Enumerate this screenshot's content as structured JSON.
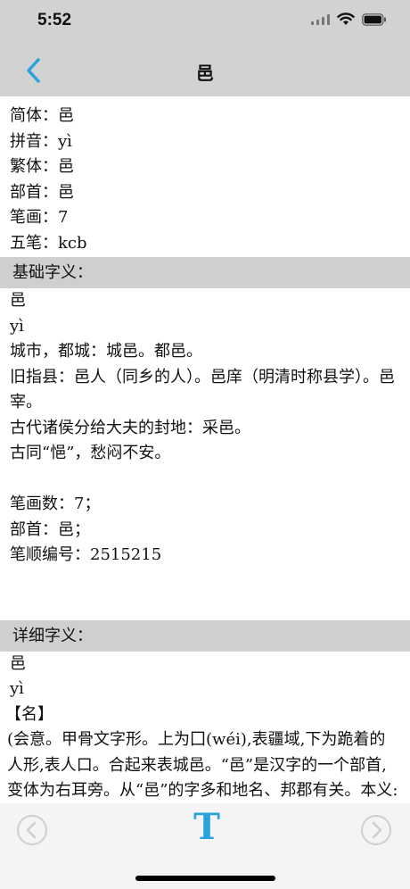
{
  "status": {
    "time": "5:52"
  },
  "nav": {
    "title": "邑"
  },
  "basic": [
    "简体：邑",
    "拼音：yì",
    "繁体：邑",
    "部首：邑",
    "笔画：7",
    "五笔：kcb"
  ],
  "sections": {
    "basic_meaning_title": "基础字义：",
    "detail_meaning_title": "详细字义："
  },
  "basic_meaning": {
    "char": "邑",
    "pinyin": "yì",
    "m1": "城市，都城：城邑。都邑。",
    "m2": "旧指县：邑人（同乡的人）。邑庠（明清时称县学）。邑宰。",
    "m3": "古代诸侯分给大夫的封地：采邑。",
    "m4": "古同“悒”，愁闷不安。",
    "strokes": "笔画数：7；",
    "radical": "部首：邑；",
    "order": "笔顺编号：2515215"
  },
  "detail_meaning": {
    "char": "邑",
    "pinyin": "yì",
    "pos": "【名】",
    "text": "(会意。甲骨文字形。上为囗(wéi),表疆域,下为跪着的人形,表人口。合起来表城邑。“邑”是汉字的一个部首,变体为右耳旁。从“邑”的字多和地名、邦郡有关。本义:国)"
  },
  "colors": {
    "accent": "#2aa3dd",
    "bar": "#d2d2d2",
    "section": "#cfcfcf"
  },
  "icons": {
    "back": "chevron-left-icon",
    "prev": "circle-left-icon",
    "font": "text-size-icon",
    "next": "circle-right-icon"
  },
  "toolbar": {
    "font_label": "T"
  }
}
